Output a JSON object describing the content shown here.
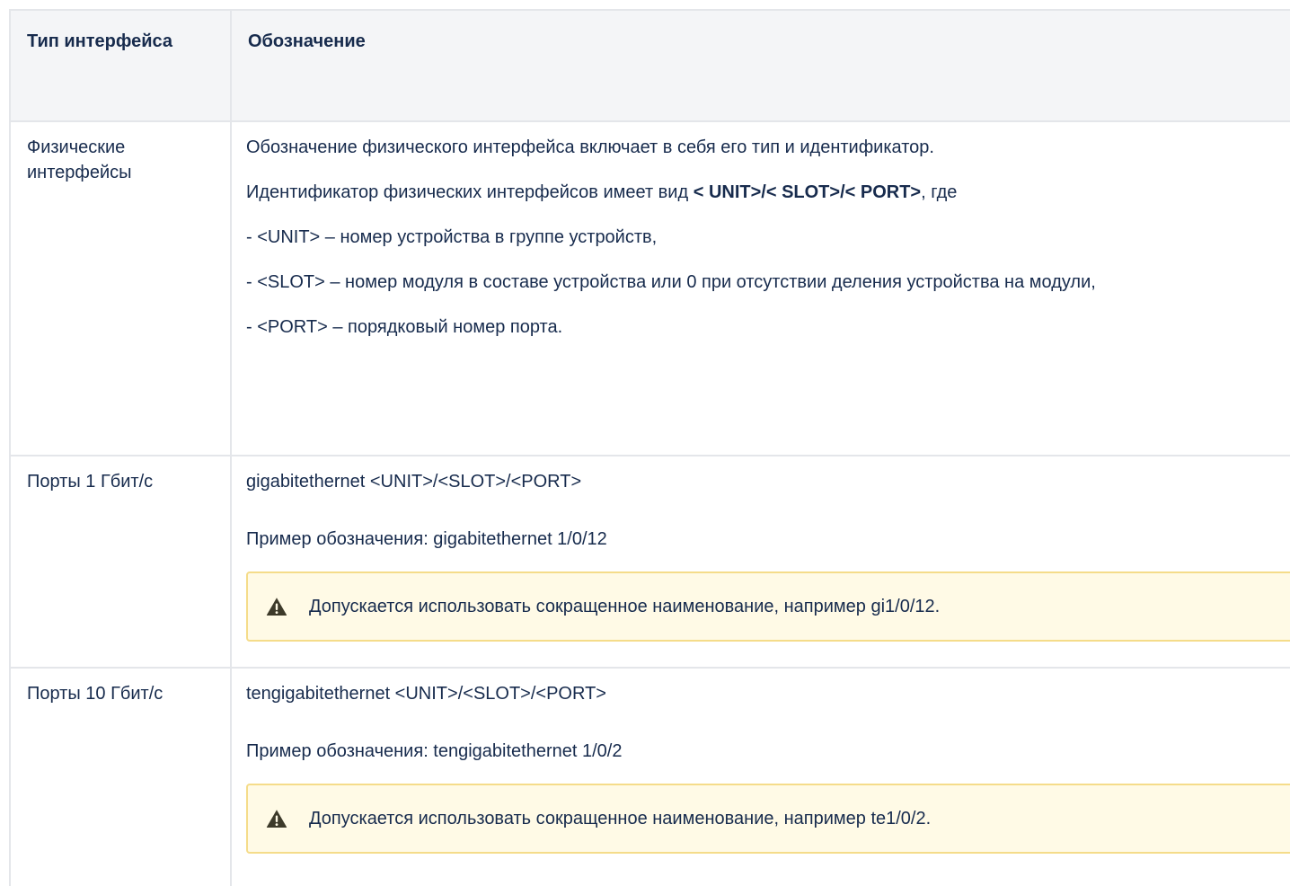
{
  "table": {
    "headers": {
      "type": "Тип интерфейса",
      "designation": "Обозначение"
    },
    "physical": {
      "label": "Физические интерфейсы",
      "p1": "Обозначение физического интерфейса включает в себя его тип и идентификатор.",
      "p2_prefix": "Идентификатор физических интерфейсов имеет вид ",
      "p2_bold": "< UNIT>/< SLOT>/< PORT>",
      "p2_suffix": ", где",
      "unit": "- <UNIT> – номер устройства в группе устройств,",
      "slot": "- <SLOT> – номер модуля в составе устройства или 0 при отсутствии деления устройства на модули,",
      "port": "- <PORT> – порядковый номер порта."
    },
    "ports_1g": {
      "label": "Порты 1 Гбит/с",
      "syntax": "gigabitethernet <UNIT>/<SLOT>/<PORT>",
      "example": "Пример обозначения: gigabitethernet 1/0/12",
      "note": "Допускается использовать сокращенное наименование, например gi1/0/12.",
      "note_icon": "warning-icon"
    },
    "ports_10g": {
      "label": "Порты 10 Гбит/с",
      "syntax": "tengigabitethernet <UNIT>/<SLOT>/<PORT>",
      "example": "Пример обозначения: tengigabitethernet 1/0/2",
      "note": "Допускается использовать сокращенное наименование, например te1/0/2.",
      "note_icon": "warning-icon"
    }
  },
  "colors": {
    "header_bg": "#f4f5f7",
    "border": "#e4e6ea",
    "note_bg": "#fffae6",
    "note_border": "#f5dc8a",
    "text": "#172b4d"
  }
}
